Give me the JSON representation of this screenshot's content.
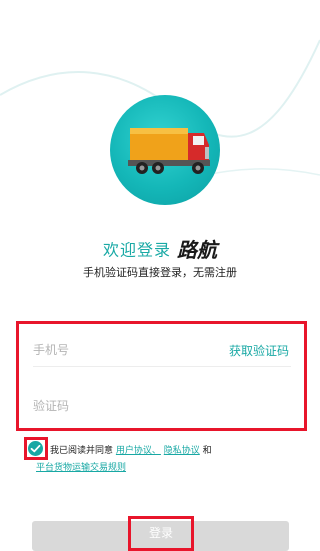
{
  "title": {
    "welcome": "欢迎登录",
    "brand": "路航"
  },
  "subtitle": "手机验证码直接登录，无需注册",
  "form": {
    "phone_placeholder": "手机号",
    "get_code_label": "获取验证码",
    "code_placeholder": "验证码"
  },
  "agreement": {
    "checked": true,
    "prefix": "我已阅读并同意",
    "user_agreement": "用户协议、",
    "privacy_policy": "隐私协议",
    "and": "和",
    "transport_rules": "平台货物运输交易规则"
  },
  "login_label": "登录",
  "colors": {
    "accent": "#18a8a4",
    "highlight": "#e8152b",
    "button_disabled": "#d9d9d9"
  },
  "icons": {
    "logo": "truck-logo-icon",
    "checkbox": "check-icon"
  }
}
